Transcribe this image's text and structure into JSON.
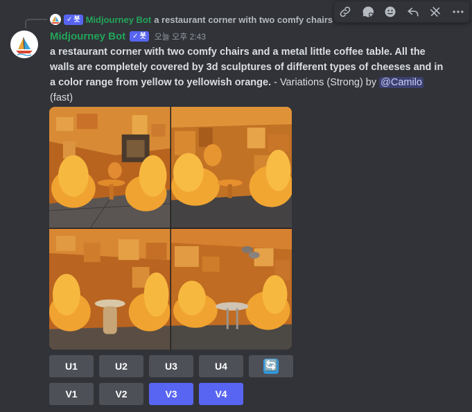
{
  "reply": {
    "bot_tag": "봇",
    "author": "Midjourney Bot",
    "text": "a restaurant corner with two comfy chairs and a metal little coffee table..."
  },
  "toolbar": {
    "icons": [
      "link-icon",
      "thread-icon",
      "emoji-icon",
      "reply-icon",
      "app-icon",
      "more-icon"
    ]
  },
  "message": {
    "author": "Midjourney Bot",
    "bot_tag": "봇",
    "timestamp": "오늘 오후 2:43",
    "prompt": "a restaurant corner with two comfy chairs and a metal little coffee table. All the walls are completely covered by 3d sculptures of different types of cheeses and in a color range from yellow to yellowish orange.",
    "suffix": " - Variations (Strong) by ",
    "mention": "@Camilo",
    "speed": " (fast)"
  },
  "buttons": {
    "row1": [
      "U1",
      "U2",
      "U3",
      "U4"
    ],
    "refresh_icon": "🔄",
    "row2": [
      {
        "label": "V1",
        "style": "secondary"
      },
      {
        "label": "V2",
        "style": "secondary"
      },
      {
        "label": "V3",
        "style": "primary"
      },
      {
        "label": "V4",
        "style": "primary"
      }
    ]
  },
  "colors": {
    "background": "#313338",
    "username": "#23a55a",
    "blurple": "#5865f2",
    "button_gray": "#4e5058"
  }
}
